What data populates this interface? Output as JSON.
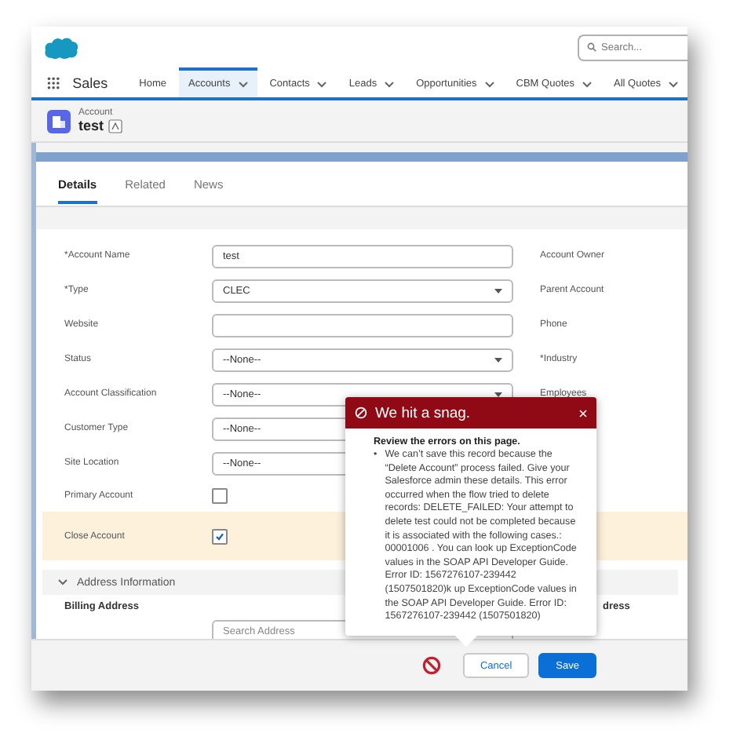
{
  "header": {
    "search": {
      "placeholder": "Search..."
    }
  },
  "nav": {
    "app_name": "Sales",
    "items": [
      {
        "label": "Home",
        "dropdown": false,
        "selected": false
      },
      {
        "label": "Accounts",
        "dropdown": true,
        "selected": true
      },
      {
        "label": "Contacts",
        "dropdown": true,
        "selected": false
      },
      {
        "label": "Leads",
        "dropdown": true,
        "selected": false
      },
      {
        "label": "Opportunities",
        "dropdown": true,
        "selected": false
      },
      {
        "label": "CBM Quotes",
        "dropdown": true,
        "selected": false
      },
      {
        "label": "All Quotes",
        "dropdown": true,
        "selected": false
      }
    ]
  },
  "record": {
    "object_label": "Account",
    "name": "test"
  },
  "tabs": [
    {
      "label": "Details",
      "selected": true
    },
    {
      "label": "Related",
      "selected": false
    },
    {
      "label": "News",
      "selected": false
    }
  ],
  "form": {
    "fields": [
      {
        "label": "*Account Name",
        "kind": "text",
        "value": "test",
        "right_label": "Account Owner"
      },
      {
        "label": "*Type",
        "kind": "select",
        "value": "CLEC",
        "right_label": "Parent Account"
      },
      {
        "label": "Website",
        "kind": "text",
        "right_label": "Phone"
      },
      {
        "label": "Status",
        "kind": "select",
        "value": "--None--",
        "right_label": "*Industry"
      },
      {
        "label": "Account Classification",
        "kind": "select",
        "value": "--None--",
        "right_label": "Employees"
      },
      {
        "label": "Customer Type",
        "kind": "select",
        "value": "--None--"
      },
      {
        "label": "Site Location",
        "kind": "select",
        "value": "--None--"
      },
      {
        "label": "Primary Account",
        "kind": "checkbox",
        "checked": false,
        "highlighted": false
      },
      {
        "label": "Close Account",
        "kind": "checkbox",
        "checked": true,
        "highlighted": true
      }
    ],
    "section": {
      "title": "Address Information",
      "expanded": true,
      "billing_label": "Billing Address",
      "billing_placeholder": "Search Address",
      "right_label": "dress"
    }
  },
  "footer": {
    "cancel": "Cancel",
    "save": "Save"
  },
  "error_popup": {
    "title": "We hit a snag.",
    "heading": "Review the errors on this page.",
    "bullet": "•",
    "errors": [
      "We can’t save this record because the “Delete Account” process failed. Give your Salesforce admin these details. This error occurred when the flow tried to delete records: DELETE_FAILED: Your attempt to delete test could not be completed because it is associated with the following cases.: 00001006 . You can look up ExceptionCode values in the SOAP API Developer Guide. Error ID: 1567276107-239442 (1507501820)k up ExceptionCode values in the SOAP API Developer Guide. Error ID: 1567276107-239442 (1507501820)"
    ]
  }
}
